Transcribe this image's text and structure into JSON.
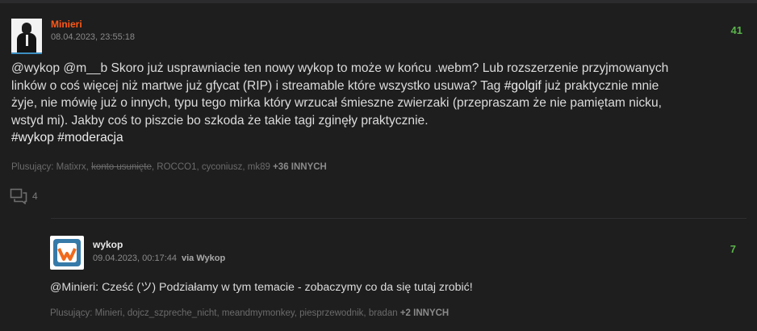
{
  "post": {
    "author": "Minieri",
    "date": "08.04.2023, 23:55:18",
    "votes": "41",
    "content_line1": "@wykop @m__b Skoro już usprawniacie ten nowy wykop to może w końcu .webm? Lub rozszerzenie przyjmowanych",
    "content_line2": "linków o coś więcej niż martwe już gfycat (RIP) i streamable które wszystko usuwa? Tag",
    "content_tag": "#golgif",
    "content_line2b": " już praktycznie mnie",
    "content_line3": "żyje, nie mówię już o innych, typu tego mirka który wrzucał śmieszne zwierzaki (przepraszam że nie pamiętam nicku,",
    "content_line4": "wstyd mi). Jakby coś to piszcie bo szkoda że takie tagi zginęły praktycznie.",
    "content_tags": "#wykop #moderacja",
    "plus_label": "Plusujący:",
    "plus_users_a": "Matixrx,",
    "plus_users_deleted": "konto usunięte",
    "plus_users_b": ", ROCCO1, cyconiusz, mk89",
    "plus_more": "+36 INNYCH",
    "comments_count": "4"
  },
  "reply": {
    "author": "wykop",
    "date": "09.04.2023, 00:17:44",
    "via": "via Wykop",
    "votes": "7",
    "text": "@Minieri: Cześć (ツ) Podziałamy w tym temacie - zobaczymy co da się tutaj zrobić!",
    "plus_label": "Plusujący:",
    "plus_users": "Minieri, dojcz_szpreche_nicht, meandmymonkey, piesprzewodnik, bradan",
    "plus_more": "+2 INNYCH"
  },
  "colors": {
    "author_accent": "#ff5917",
    "votes": "#5bb44a",
    "background": "#1e1e1f"
  },
  "icons": {
    "comments": "speech-bubbles-icon",
    "wykop_logo": "wykop-logo-icon"
  }
}
